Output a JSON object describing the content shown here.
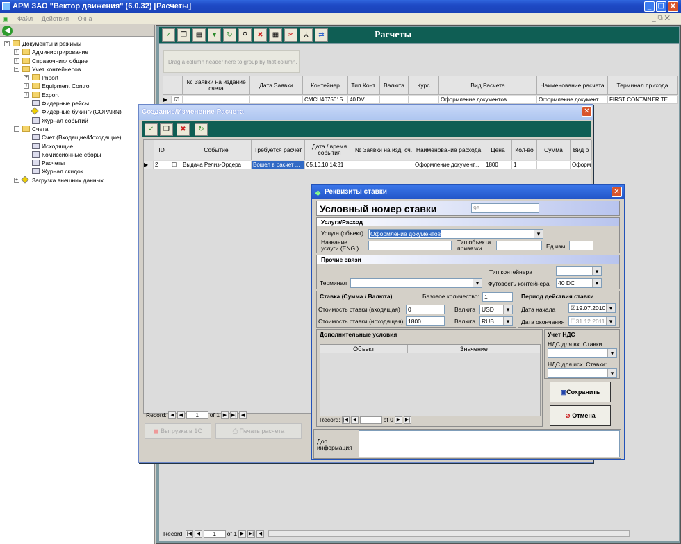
{
  "app": {
    "title": "АРМ ЗАО \"Вектор движения\" (6.0.32)  [Расчеты]",
    "menu": [
      "Файл",
      "Действия",
      "Окна"
    ],
    "mdi_controls": "_ ⧉ ✕"
  },
  "tree": [
    {
      "label": "Документы и режимы",
      "level": 0,
      "pm": "−",
      "icon": "folder"
    },
    {
      "label": "Администрирование",
      "level": 1,
      "pm": "+",
      "icon": "folder"
    },
    {
      "label": "Справочники общие",
      "level": 1,
      "pm": "+",
      "icon": "folder"
    },
    {
      "label": "Учет контейнеров",
      "level": 1,
      "pm": "−",
      "icon": "folder"
    },
    {
      "label": "Import",
      "level": 2,
      "pm": "+",
      "icon": "folder"
    },
    {
      "label": "Equipment Control",
      "level": 2,
      "pm": "+",
      "icon": "folder"
    },
    {
      "label": "Export",
      "level": 2,
      "pm": "+",
      "icon": "folder"
    },
    {
      "label": "Фидерные рейсы",
      "level": 2,
      "pm": "",
      "icon": "doc"
    },
    {
      "label": "Фидерные букинги(COPARN)",
      "level": 2,
      "pm": "",
      "icon": "diamond"
    },
    {
      "label": "Журнал событий",
      "level": 2,
      "pm": "",
      "icon": "doc"
    },
    {
      "label": "Счета",
      "level": 1,
      "pm": "−",
      "icon": "folder"
    },
    {
      "label": "Счет (Входящие/Исходящие)",
      "level": 2,
      "pm": "",
      "icon": "doc"
    },
    {
      "label": "Исходящие",
      "level": 2,
      "pm": "",
      "icon": "doc"
    },
    {
      "label": "Комиссионные сборы",
      "level": 2,
      "pm": "",
      "icon": "doc"
    },
    {
      "label": "Расчеты",
      "level": 2,
      "pm": "",
      "icon": "doc"
    },
    {
      "label": "Журнал скидок",
      "level": 2,
      "pm": "",
      "icon": "doc"
    },
    {
      "label": "Загрузка внешних данных",
      "level": 1,
      "pm": "+",
      "icon": "diamond"
    }
  ],
  "main": {
    "title": "Расчеты",
    "group_hint": "Drag a column header here to group by that column.",
    "columns": [
      "№ Заявки на издание счета",
      "Дата Заявки",
      "Контейнер",
      "Тип Конт.",
      "Валюта",
      "Курс",
      "Вид Расчета",
      "Наименование расчета",
      "Терминал прихода"
    ],
    "row": [
      "",
      "",
      "CMCU4075615",
      "40'DV",
      "",
      "",
      "Оформление документов",
      "Оформление документ...",
      "FIRST CONTAINER TE..."
    ],
    "record_label": "Record:",
    "record_value": "1",
    "record_of": "of 1"
  },
  "dlg1": {
    "title": "Создание/Изменение Расчета",
    "columns": [
      "ID",
      "",
      "Событие",
      "Требуется расчет",
      "Дата / время события",
      "№ Заявки на изд. сч.",
      "Наименование расхода",
      "Цена",
      "Кол-во",
      "Сумма",
      "Вид р"
    ],
    "row": [
      "2",
      "",
      "Выдача Релиз-Ордера",
      "Вошел в расчет ...",
      "05.10.10 14:31",
      "",
      "Оформление документ...",
      "1800",
      "1",
      "",
      "Оформ"
    ],
    "record_label": "Record:",
    "record_value": "1",
    "record_of": "of 1",
    "export_btn": "Выгрузка в 1С",
    "print_btn": "Печать расчета"
  },
  "dlg2": {
    "title": "Реквизиты ставки",
    "rate_number_label": "Условный номер ставки",
    "rate_number": "95",
    "service_section": "Услуга/Расход",
    "service_label": "Услуга (объект)",
    "service_value": "Оформление документов",
    "name_eng_label": "Название услуги (ENG.)",
    "name_eng": "",
    "object_type_label": "Тип объекта привязки",
    "object_type": "",
    "unit_label": "Ед.изм.",
    "unit": "",
    "other_section": "Прочие связи",
    "terminal_label": "Терминал",
    "terminal": "",
    "cont_type_label": "Тип контейнера",
    "cont_type": "",
    "footage_label": "Футовость контейнера",
    "footage": "40 DC",
    "rate_section": "Ставка (Сумма / Валюта)",
    "base_qty_label": "Базовое количество:",
    "base_qty": "1",
    "cost_in_label": "Стоимость ставки (входящая)",
    "cost_in": "0",
    "currency_label": "Валюта",
    "currency_in": "USD",
    "cost_out_label": "Стоимость ставки (исходящая)",
    "cost_out": "1800",
    "currency_out": "RUB",
    "period_section": "Период действия ставки",
    "start_label": "Дата начала",
    "start_date": "19.07.2010",
    "end_label": "Дата окончания",
    "end_date": "31.12.2011",
    "extra_section": "Дополнительные условия",
    "extra_cols": [
      "Объект",
      "Значение"
    ],
    "record_label": "Record:",
    "record_of": "of 0",
    "vat_section": "Учет НДС",
    "vat_in_label": "НДС для вх. Ставки",
    "vat_out_label": "НДС для исх. Ставки:",
    "save_btn": "Сохранить",
    "cancel_btn": "Отмена",
    "info_label": "Доп. информация"
  },
  "colors": {
    "titlebar": "#1e49c4",
    "toolbar": "#0f5e54",
    "workspace": "#7e9aa1"
  }
}
